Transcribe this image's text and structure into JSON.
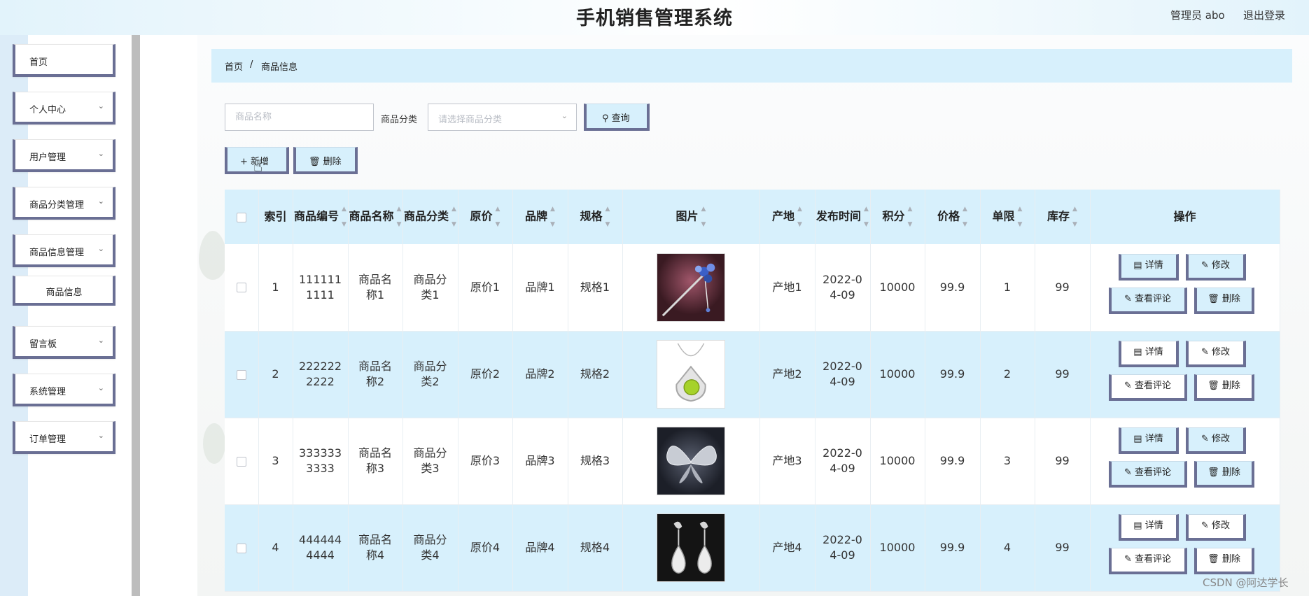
{
  "header": {
    "title": "手机销售管理系统",
    "admin_label": "管理员 abo",
    "logout_label": "退出登录"
  },
  "sidebar": {
    "items": [
      {
        "label": "首页",
        "has_children": false
      },
      {
        "label": "个人中心",
        "has_children": true
      },
      {
        "label": "用户管理",
        "has_children": true
      },
      {
        "label": "商品分类管理",
        "has_children": true
      },
      {
        "label": "商品信息管理",
        "has_children": true
      },
      {
        "label": "留言板",
        "has_children": true
      },
      {
        "label": "系统管理",
        "has_children": true
      },
      {
        "label": "订单管理",
        "has_children": true
      }
    ],
    "sub_item": "商品信息",
    "chevron": "chevron-down-icon"
  },
  "breadcrumb": {
    "home": "首页",
    "separator": "/",
    "current": "商品信息"
  },
  "search": {
    "name_placeholder": "商品名称",
    "category_label": "商品分类",
    "category_placeholder": "请选择商品分类",
    "query_label": "查询"
  },
  "toolbar": {
    "add_label": "新增",
    "delete_label": "删除"
  },
  "table": {
    "headers": [
      "索引",
      "商品编号",
      "商品名称",
      "商品分类",
      "原价",
      "品牌",
      "规格",
      "图片",
      "产地",
      "发布时间",
      "积分",
      "价格",
      "单限",
      "库存",
      "操作"
    ],
    "rows": [
      {
        "index": "1",
        "code": "1111111111",
        "name": "商品名称1",
        "category": "商品分类1",
        "original_price": "原价1",
        "brand": "品牌1",
        "spec": "规格1",
        "image": "hairpin-image",
        "origin": "产地1",
        "date": "2022-04-09",
        "points": "10000",
        "price": "99.9",
        "limit": "1",
        "stock": "99"
      },
      {
        "index": "2",
        "code": "2222222222",
        "name": "商品名称2",
        "category": "商品分类2",
        "original_price": "原价2",
        "brand": "品牌2",
        "spec": "规格2",
        "image": "pendant-necklace-image",
        "origin": "产地2",
        "date": "2022-04-09",
        "points": "10000",
        "price": "99.9",
        "limit": "2",
        "stock": "99"
      },
      {
        "index": "3",
        "code": "3333333333",
        "name": "商品名称3",
        "category": "商品分类3",
        "original_price": "原价3",
        "brand": "品牌3",
        "spec": "规格3",
        "image": "butterfly-brooch-image",
        "origin": "产地3",
        "date": "2022-04-09",
        "points": "10000",
        "price": "99.9",
        "limit": "3",
        "stock": "99"
      },
      {
        "index": "4",
        "code": "4444444444",
        "name": "商品名称4",
        "category": "商品分类4",
        "original_price": "原价4",
        "brand": "品牌4",
        "spec": "规格4",
        "image": "drop-earrings-image",
        "origin": "产地4",
        "date": "2022-04-09",
        "points": "10000",
        "price": "99.9",
        "limit": "4",
        "stock": "99"
      }
    ],
    "actions": {
      "detail": "详情",
      "edit": "修改",
      "comments": "查看评论",
      "delete": "删除"
    }
  },
  "watermark": "CSDN @阿达学长",
  "colors": {
    "accent_light": "#d7f0fc",
    "border_accent": "#6a6f94"
  }
}
